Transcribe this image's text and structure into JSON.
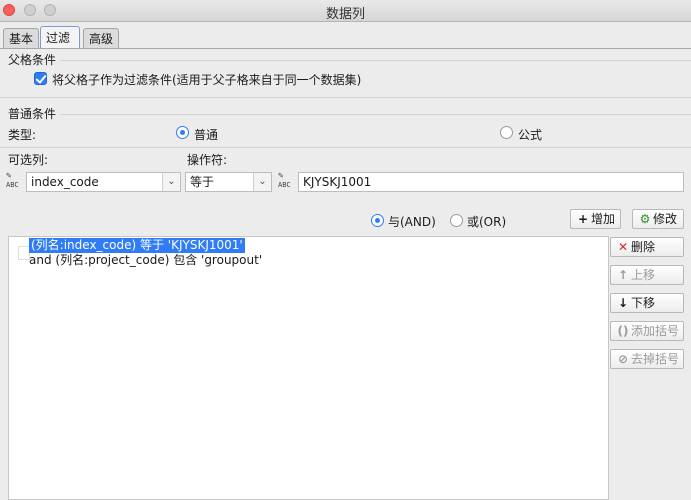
{
  "window": {
    "title": "数据列"
  },
  "tabs": [
    {
      "label": "基本",
      "active": false
    },
    {
      "label": "过滤",
      "active": true
    },
    {
      "label": "高级",
      "active": false
    }
  ],
  "parent_condition": {
    "group_label": "父格条件",
    "checkbox_label": "将父格子作为过滤条件(适用于父子格来自于同一个数据集)",
    "checked": true
  },
  "normal_condition": {
    "group_label": "普通条件",
    "type_label": "类型:",
    "type_options": [
      {
        "label": "普通",
        "selected": true
      },
      {
        "label": "公式",
        "selected": false
      }
    ],
    "column_label": "可选列:",
    "operator_label": "操作符:",
    "column_value": "index_code",
    "operator_value": "等于",
    "value_text": "KJYSKJ1001"
  },
  "logic": {
    "and_label": "与(AND)",
    "or_label": "或(OR)",
    "selected": "and"
  },
  "buttons": {
    "add": "增加",
    "modify": "修改",
    "delete": "删除",
    "move_up": "上移",
    "move_down": "下移",
    "add_bracket": "添加括号",
    "remove_bracket": "去掉括号"
  },
  "icons": {
    "add": "plus-icon",
    "modify": "gear-edit-icon",
    "delete": "x-icon",
    "move_up": "arrow-up-icon",
    "move_down": "arrow-down-icon",
    "add_bracket": "bracket-icon",
    "remove_bracket": "remove-bracket-icon",
    "abc": "abc-icon"
  },
  "abc_text": "ABC",
  "conditions": [
    {
      "text": "(列名:index_code) 等于 'KJYSKJ1001'",
      "selected": true
    },
    {
      "text": "and (列名:project_code) 包含 'groupout'",
      "selected": false
    }
  ]
}
